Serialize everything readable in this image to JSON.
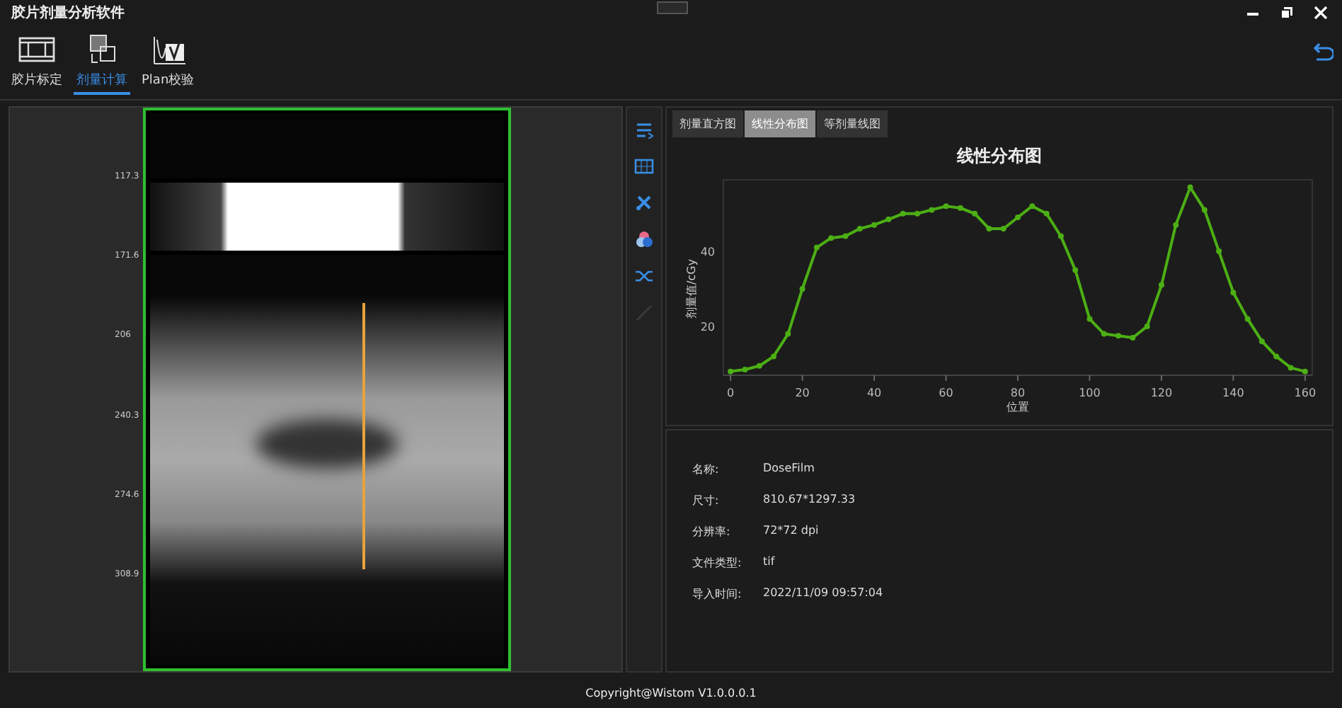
{
  "window": {
    "title": "胶片剂量分析软件"
  },
  "modules": [
    {
      "label": "胶片标定",
      "selected": false
    },
    {
      "label": "剂量计算",
      "selected": true
    },
    {
      "label": "Plan校验",
      "selected": false
    }
  ],
  "viewer": {
    "ruler_labels": [
      "117.3",
      "171.6",
      "206",
      "240.3",
      "274.6",
      "308.9"
    ]
  },
  "tools": [
    {
      "disabled": false
    },
    {
      "disabled": false
    },
    {
      "disabled": false
    },
    {
      "disabled": false
    },
    {
      "disabled": false
    },
    {
      "disabled": true
    }
  ],
  "chart_tabs": [
    {
      "label": "剂量直方图",
      "selected": false
    },
    {
      "label": "线性分布图",
      "selected": true
    },
    {
      "label": "等剂量线图",
      "selected": false
    }
  ],
  "chart": {
    "chart_data": {
      "type": "line",
      "title": "线性分布图",
      "xlabel": "位置",
      "ylabel": "剂量值/cGy",
      "xlim": [
        -2,
        162
      ],
      "ylim": [
        7,
        59
      ],
      "xticks": [
        0,
        20,
        40,
        60,
        80,
        100,
        120,
        140,
        160
      ],
      "yticks": [
        20,
        40
      ],
      "x": [
        0,
        4,
        8,
        12,
        16,
        20,
        24,
        28,
        32,
        36,
        40,
        44,
        48,
        52,
        56,
        60,
        64,
        68,
        72,
        76,
        80,
        84,
        88,
        92,
        96,
        100,
        104,
        108,
        112,
        116,
        120,
        124,
        128,
        132,
        136,
        140,
        144,
        148,
        152,
        156,
        160
      ],
      "series": [
        {
          "color": "#4caf14",
          "marker": "circle",
          "values": [
            8,
            8.5,
            9.5,
            12,
            18,
            30,
            41,
            43.5,
            44,
            46,
            47,
            48.5,
            50,
            50,
            51,
            52,
            51.5,
            50,
            46,
            46,
            49,
            52,
            50,
            44,
            35,
            22,
            18,
            17.5,
            17,
            20,
            31,
            47,
            57,
            51,
            40,
            29,
            22,
            16,
            12,
            9,
            8
          ]
        }
      ]
    }
  },
  "info": [
    {
      "label": "名称:",
      "value": "DoseFilm"
    },
    {
      "label": "尺寸:",
      "value": "810.67*1297.33"
    },
    {
      "label": "分辨率:",
      "value": "72*72 dpi"
    },
    {
      "label": "文件类型:",
      "value": "tif"
    },
    {
      "label": "导入时间:",
      "value": "2022/11/09 09:57:04"
    }
  ],
  "status_bar": {
    "text": "Copyright@Wistom V1.0.0.0.1"
  }
}
